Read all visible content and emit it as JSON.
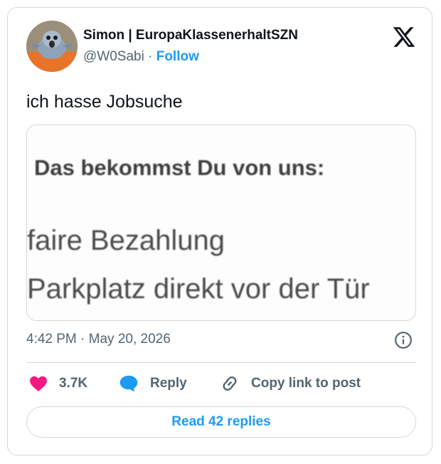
{
  "author": {
    "display_name": "Simon | EuropaKlassenerhaltSZN",
    "handle": "@W0Sabi",
    "separator": "·",
    "follow_label": "Follow",
    "avatar_icon": "avatar-pigeon"
  },
  "brand": {
    "logo_icon": "x-logo-icon"
  },
  "tweet": {
    "text": "ich hasse Jobsuche",
    "media": {
      "heading": "Das bekommst Du von uns:",
      "line1": "faire Bezahlung",
      "line2": "Parkplatz direkt vor der Tür"
    },
    "timestamp": "4:42 PM · May 20, 2026"
  },
  "actions": {
    "like_count": "3.7K",
    "reply_label": "Reply",
    "copy_label": "Copy link to post",
    "read_replies_label": "Read 42 replies"
  },
  "colors": {
    "accent": "#1d9bf0",
    "like": "#f91880",
    "muted": "#536471",
    "border": "#cfd9de"
  }
}
